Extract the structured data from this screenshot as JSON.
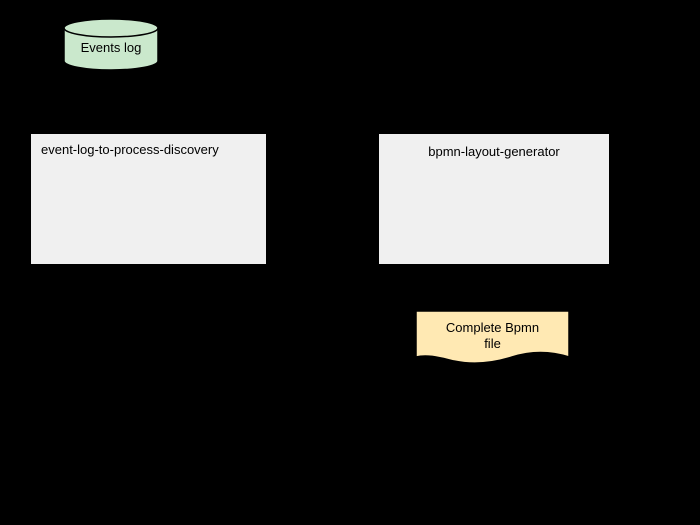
{
  "diagram": {
    "cylinder": {
      "label": "Events log"
    },
    "box1": {
      "label": "event-log-to-process-discovery"
    },
    "box2": {
      "label": "bpmn-layout-generator"
    },
    "document": {
      "line1": "Complete Bpmn",
      "line2": "file"
    }
  }
}
